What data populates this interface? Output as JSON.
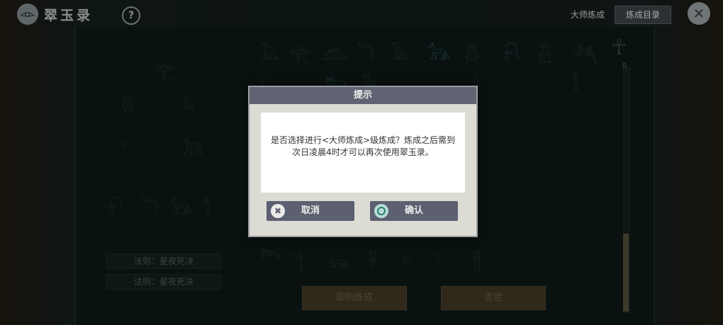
{
  "app": {
    "title": "翠玉录",
    "logo_icon": "pharaoh-head-icon",
    "help_icon": "question-icon"
  },
  "header": {
    "mode_label": "大师炼成",
    "catalog_button": "炼成目录",
    "close_icon": "close-icon"
  },
  "board": {
    "rules": [
      "法则：星夜死决",
      "法则：星夜死决"
    ],
    "buttons": {
      "instant": "即刻炼成",
      "deny": "否定"
    }
  },
  "dialog": {
    "title": "提示",
    "message": "是否选择进行<大师炼成>级炼成？炼成之后需到次日凌晨4时才可以再次使用翠玉录。",
    "cancel": "取消",
    "confirm": "确认"
  },
  "slider": {
    "value": "0"
  }
}
